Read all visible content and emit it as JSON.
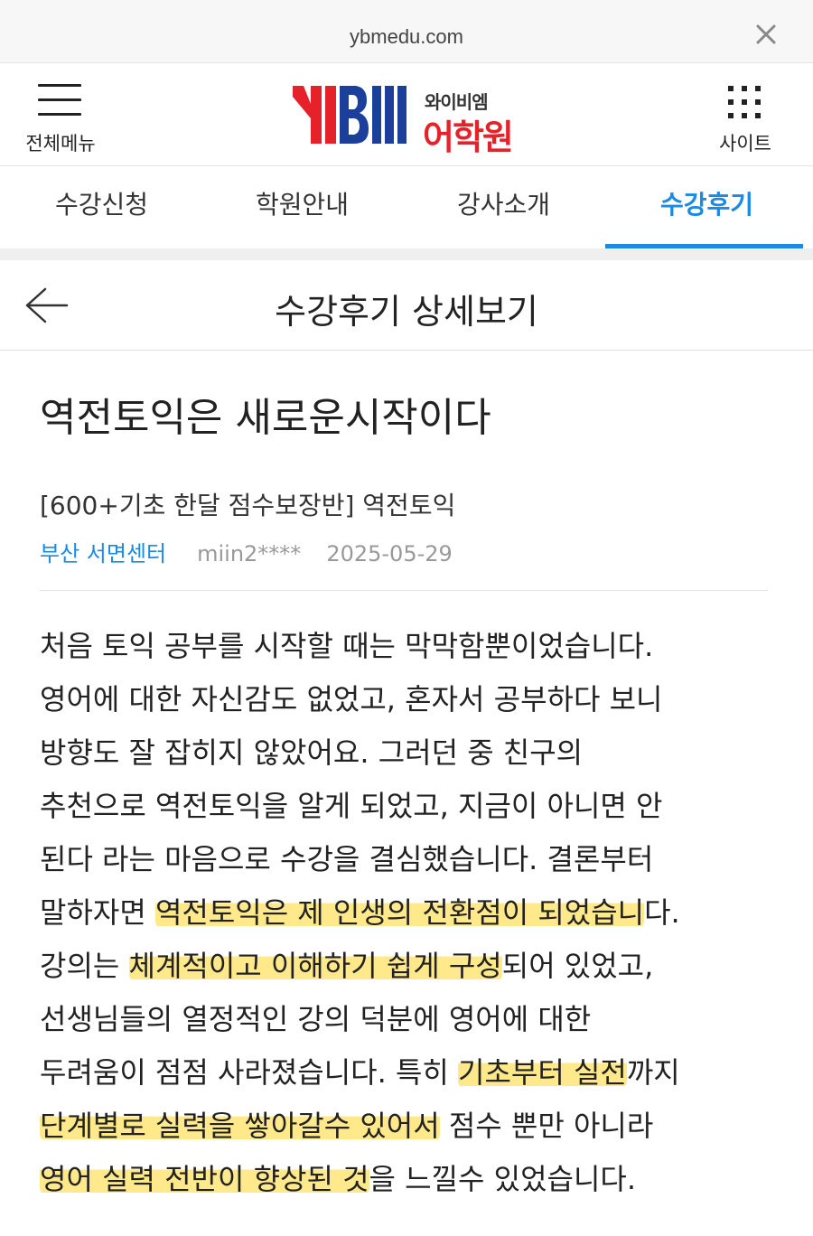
{
  "browser": {
    "url": "ybmedu.com"
  },
  "header": {
    "menu_label": "전체메뉴",
    "logo_small": "와이비엠",
    "logo_big": "어학원",
    "site_label": "사이트"
  },
  "tabs": [
    {
      "label": "수강신청"
    },
    {
      "label": "학원안내"
    },
    {
      "label": "강사소개"
    },
    {
      "label": "수강후기",
      "active": true
    }
  ],
  "page": {
    "title": "수강후기 상세보기"
  },
  "post": {
    "title": "역전토익은 새로운시작이다",
    "course": "[600+기초 한달 점수보장반] 역전토익",
    "center": "부산 서면센터",
    "user": "miin2****",
    "date": "2025-05-29",
    "lines": [
      "처음 토익 공부를 시작할 때는 막막함뿐이었습니다.",
      "영어에 대한 자신감도 없었고, 혼자서 공부하다 보니",
      "방향도 잘 잡히지 않았어요. 그러던 중 친구의",
      "추천으로 역전토익을 알게 되었고, 지금이 아니면 안",
      "된다 라는 마음으로 수강을 결심했습니다. 결론부터",
      "말하자면 역전토익은 제 인생의 전환점이 되었습니다.",
      "강의는 체계적이고 이해하기 쉽게 구성되어 있었고,",
      "선생님들의 열정적인 강의 덕분에 영어에 대한",
      "두려움이 점점 사라졌습니다. 특히 기초부터 실전까지",
      "단계별로 실력을 쌓아갈수 있어서 점수 뿐만 아니라",
      "영어 실력 전반이 향상된 것을 느낄수 있었습니다."
    ],
    "highlighted": [
      "역전토익은 제 인생의 전환점이 되었습니",
      "체계적이고 이해하기 쉽게 구성",
      "기초부터 실전",
      "단계별로 실력을 쌓아갈수 있어서",
      "영어 실력 전반이 향상된 것"
    ]
  },
  "colors": {
    "accent": "#1a8ae5",
    "brand_red": "#e52229",
    "brand_blue": "#1b3f9b",
    "highlight": "#ffe98a"
  },
  "icons": {
    "close": "close-icon",
    "menu": "hamburger-icon",
    "site": "grid-dots-icon",
    "back": "arrow-left-icon"
  }
}
